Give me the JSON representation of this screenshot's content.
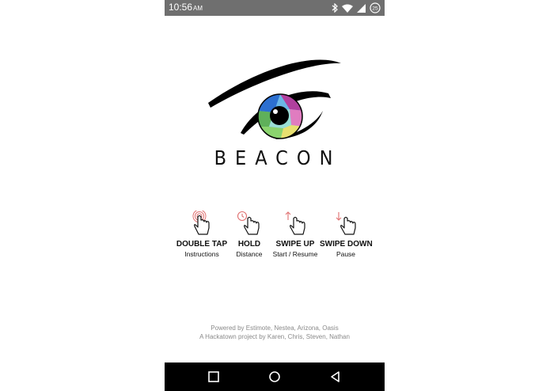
{
  "status_bar": {
    "time": "10:56",
    "ampm": "AM",
    "battery_level": "25"
  },
  "app": {
    "name": "BEACON"
  },
  "gestures": [
    {
      "title": "DOUBLE TAP",
      "subtitle": "Instructions",
      "icon": "double-tap-icon"
    },
    {
      "title": "HOLD",
      "subtitle": "Distance",
      "icon": "hold-clock-icon"
    },
    {
      "title": "SWIPE UP",
      "subtitle": "Start / Resume",
      "icon": "swipe-up-icon"
    },
    {
      "title": "SWIPE DOWN",
      "subtitle": "Pause",
      "icon": "swipe-down-icon"
    }
  ],
  "footer": {
    "powered_by": "Powered by Estimote, Nestea, Arizona, Oasis",
    "credits": "A Hackatown project by Karen, Chris, Steven, Nathan"
  },
  "colors": {
    "status_bar": "#6f6f6f",
    "accent_red": "#e07070",
    "nav_bar": "#000000"
  }
}
